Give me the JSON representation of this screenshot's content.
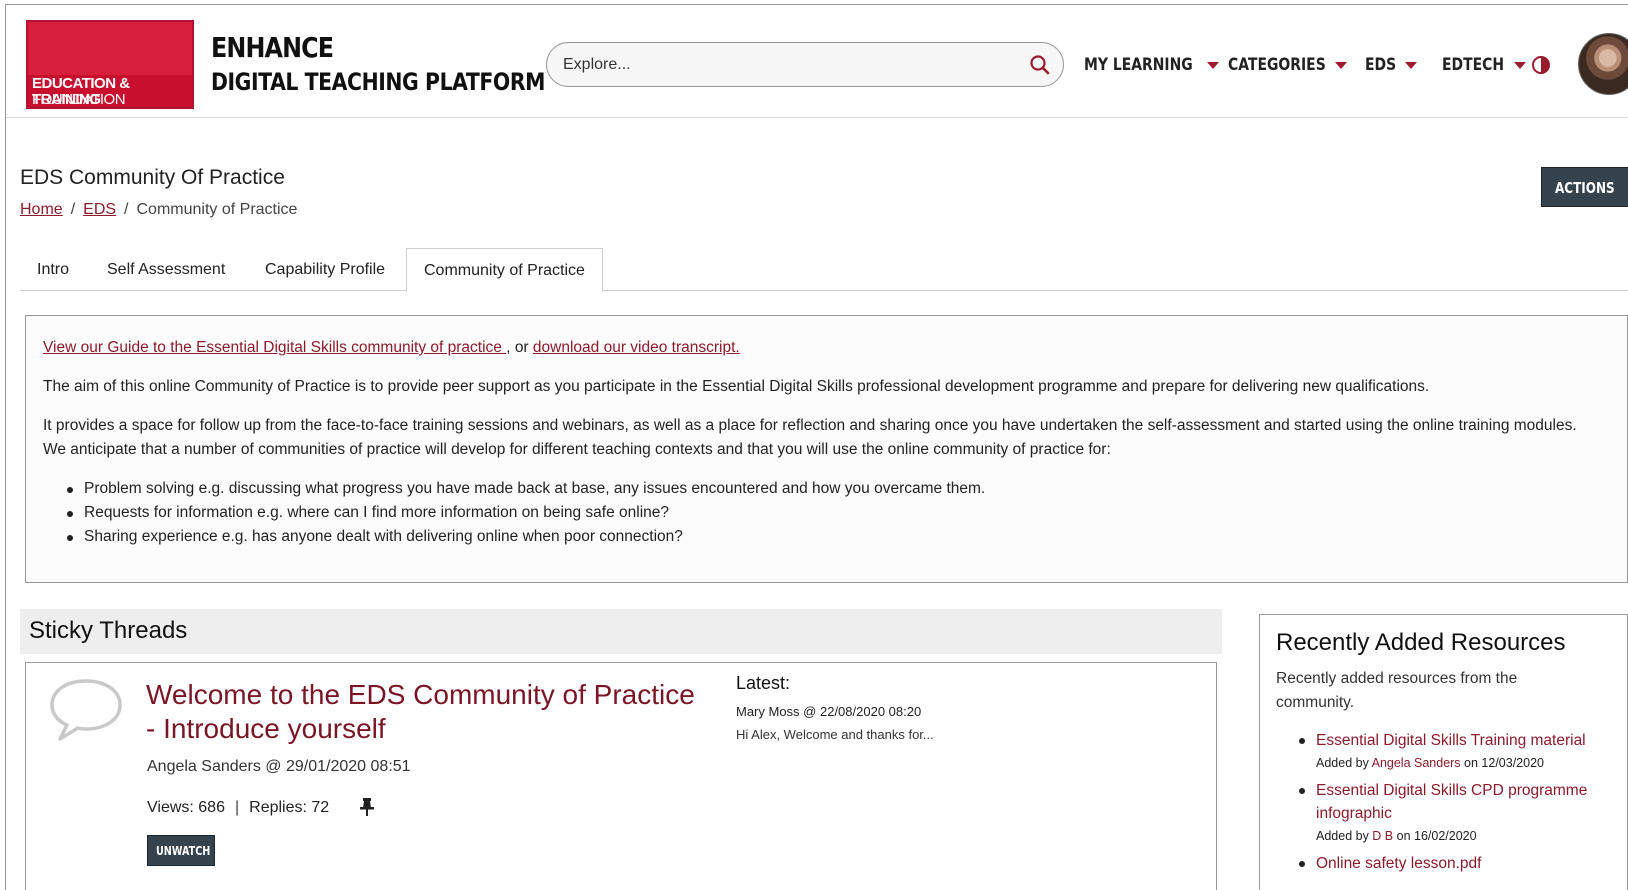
{
  "header": {
    "logo_line1": "EDUCATION & TRAINING",
    "logo_line2": "FOUNDATION",
    "brand_title": "ENHANCE",
    "brand_subtitle": "DIGITAL TEACHING PLATFORM",
    "search_placeholder": "Explore...",
    "nav": [
      {
        "label": "MY LEARNING"
      },
      {
        "label": "CATEGORIES"
      },
      {
        "label": "EDS"
      },
      {
        "label": "EDTECH"
      }
    ],
    "accent_color": "#c8102e"
  },
  "page": {
    "title": "EDS Community Of Practice",
    "breadcrumb": {
      "home": "Home",
      "eds": "EDS",
      "current": "Community of Practice",
      "separator": "/"
    },
    "actions_label": "ACTIONS"
  },
  "tabs": [
    {
      "label": "Intro"
    },
    {
      "label": "Self Assessment"
    },
    {
      "label": "Capability Profile"
    },
    {
      "label": "Community of Practice",
      "active": true
    }
  ],
  "intro": {
    "guide_link": "View our Guide to the Essential Digital Skills community of practice ",
    "or_text": ", or ",
    "transcript_link": "download our video transcript.",
    "para1": "The aim of this online Community of Practice is to provide peer support as you participate in the Essential Digital Skills professional development programme and prepare for delivering new qualifications.",
    "para2": "It provides a space for follow up from the face-to-face training sessions and webinars, as well as a place for reflection and sharing once you have undertaken the self-assessment and started using the online training modules. We anticipate that a number of communities of practice will develop for different teaching contexts and that you will use the online community of practice for:",
    "bullets": [
      "Problem solving e.g. discussing what progress you have made back at base, any issues encountered and how you overcame them.",
      "Requests for information e.g. where can I find more information on being safe online?",
      "Sharing experience e.g. has anyone dealt with delivering online when poor connection?"
    ]
  },
  "sticky": {
    "heading": "Sticky Threads",
    "thread": {
      "title": "Welcome to the EDS Community of Practice - Introduce yourself",
      "author_date": "Angela Sanders @ 29/01/2020 08:51",
      "views": "Views: 686",
      "replies": "Replies: 72",
      "stats_sep": "|",
      "unwatch_label": "UNWATCH",
      "latest_label": "Latest:",
      "latest_by": "Mary Moss @ 22/08/2020 08:20",
      "latest_snippet": "Hi Alex, Welcome and thanks for..."
    }
  },
  "resources": {
    "title": "Recently Added Resources",
    "description": "Recently added resources from the community.",
    "added_by_prefix": "Added by ",
    "on_word": " on ",
    "items": [
      {
        "title": "Essential Digital Skills Training material",
        "by": "Angela Sanders",
        "date": "12/03/2020"
      },
      {
        "title": "Essential Digital Skills CPD programme infographic",
        "by": "D B",
        "date": "16/02/2020"
      },
      {
        "title": "Online safety lesson.pdf"
      }
    ]
  }
}
